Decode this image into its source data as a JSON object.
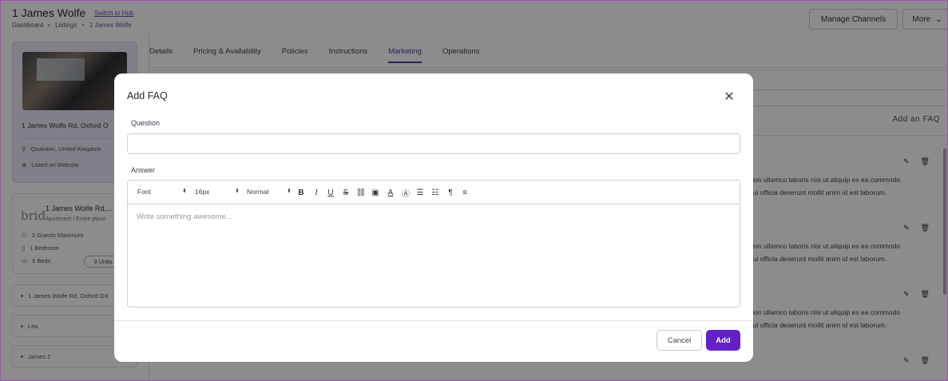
{
  "page": {
    "title": "1 James Wolfe",
    "switch_link": "Switch to Hub",
    "breadcrumbs": [
      "Dashboard",
      "Listings",
      "1 James Wolfe"
    ],
    "manage_channels": "Manage Channels",
    "more": "More"
  },
  "property": {
    "address": "1 James Wolfe Rd, Oxford O",
    "location": "Quainton, United Kingdom",
    "listed": "Listed on Website"
  },
  "info": {
    "brand": "brid",
    "name": "1 James Wolfe Rd,...",
    "type": "Apartment / Entire place",
    "guests": "3 Guests Maximum",
    "bedrooms": "1 Bedroom",
    "beds": "5 Beds",
    "units": "3 Units"
  },
  "units": [
    "1 James Wolfe Rd, Oxford OX",
    "Lea",
    "James 2"
  ],
  "tabs": [
    "Details",
    "Pricing & Availability",
    "Policies",
    "Instructions",
    "Marketing",
    "Operations"
  ],
  "faq": {
    "add_link": "Add an FAQ",
    "line1": "itation ullamco laboris nisi ut aliquip ex ea commodo",
    "line2": "a qui officia deserunt mollit anim id est laborum."
  },
  "modal": {
    "title": "Add FAQ",
    "question_label": "Question",
    "question_value": "",
    "answer_label": "Answer",
    "font": "Font",
    "size": "16px",
    "heading": "Normal",
    "placeholder": "Write something awesome...",
    "cancel": "Cancel",
    "add": "Add"
  },
  "colors": {
    "accent": "#6320c7",
    "tab_active": "#4b3aa0",
    "card_bg": "#eee8f7"
  }
}
